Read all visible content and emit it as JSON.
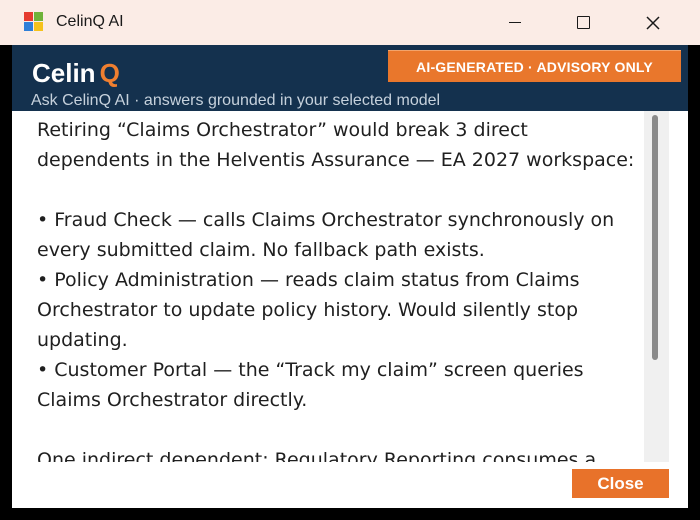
{
  "window": {
    "title": "CelinQ AI"
  },
  "header": {
    "brand_main": "Celin",
    "brand_accent": "Q",
    "subtitle": "Ask CelinQ AI · answers grounded in your selected model",
    "badge": "AI-GENERATED · ADVISORY ONLY"
  },
  "answer": {
    "intro": "Retiring “Claims Orchestrator” would break 3 direct dependents in the Helventis Assurance — EA 2027 workspace:",
    "bullets": [
      "• Fraud Check — calls Claims Orchestrator synchronously on every submitted claim. No fallback path exists.",
      "• Policy Administration — reads claim status from Claims Orchestrator to update policy history. Would silently stop updating.",
      "• Customer Portal — the “Track my claim” screen queries Claims Orchestrator directly."
    ],
    "trailing": "One indirect dependent: Regulatory Reporting consumes a"
  },
  "footer": {
    "close_label": "Close"
  },
  "colors": {
    "accent": "#e8722a",
    "header_bg": "#14314e",
    "titlebar_bg": "#fbece6"
  },
  "icons": {
    "app": "app-logo-icon",
    "minimize": "minimize-icon",
    "maximize": "maximize-icon",
    "close": "close-icon"
  }
}
